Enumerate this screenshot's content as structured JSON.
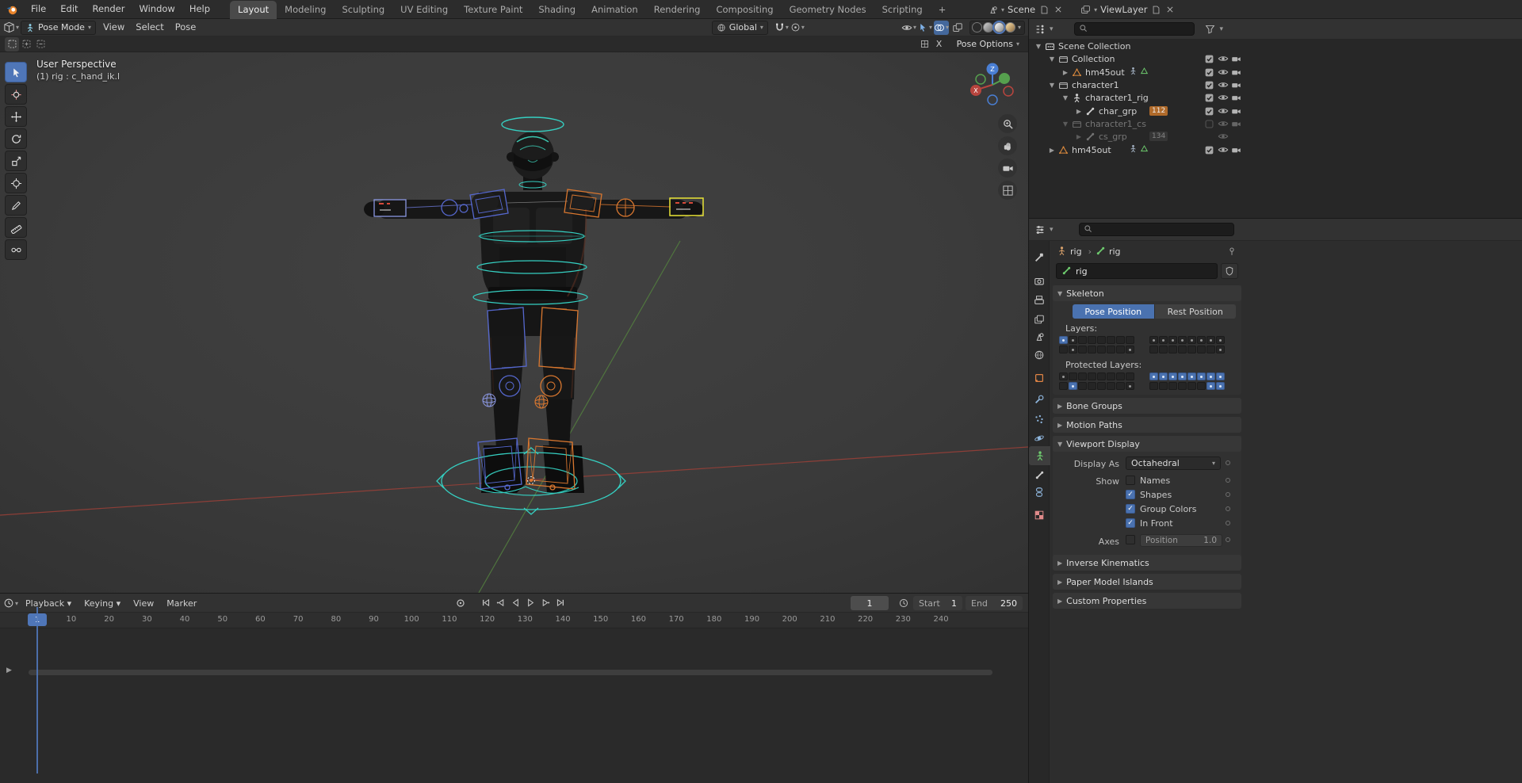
{
  "topbar": {
    "menus": [
      "File",
      "Edit",
      "Render",
      "Window",
      "Help"
    ],
    "tabs": [
      "Layout",
      "Modeling",
      "Sculpting",
      "UV Editing",
      "Texture Paint",
      "Shading",
      "Animation",
      "Rendering",
      "Compositing",
      "Geometry Nodes",
      "Scripting"
    ],
    "active_tab": "Layout",
    "add_tab_label": "+",
    "scene_label": "Scene",
    "view_layer_label": "ViewLayer"
  },
  "viewport": {
    "mode": "Pose Mode",
    "menus": [
      "View",
      "Select",
      "Pose"
    ],
    "orientation": "Global",
    "pose_options_label": "Pose Options",
    "mirror_x_label": "X",
    "perspective_label": "User Perspective",
    "active_object_label": "(1) rig : c_hand_ik.l",
    "axis_z": "Z",
    "axis_x": "X"
  },
  "outliner": {
    "rows": [
      {
        "label": "Scene Collection",
        "indent": 0,
        "icon": "scene-collection",
        "disclosure": "open",
        "dim": false,
        "controls": []
      },
      {
        "label": "Collection",
        "indent": 1,
        "icon": "collection",
        "disclosure": "open",
        "dim": false,
        "controls": [
          "check",
          "eye",
          "camera"
        ]
      },
      {
        "label": "hm45out",
        "indent": 2,
        "icon": "mesh",
        "disclosure": "closed",
        "dim": false,
        "extras": [
          "mod",
          "meshdata"
        ],
        "controls": [
          "check",
          "eye",
          "camera"
        ]
      },
      {
        "label": "character1",
        "indent": 1,
        "icon": "collection",
        "disclosure": "open",
        "dim": false,
        "controls": [
          "check",
          "eye",
          "camera"
        ]
      },
      {
        "label": "character1_rig",
        "indent": 2,
        "icon": "armature",
        "disclosure": "open",
        "dim": false,
        "controls": [
          "check",
          "eye",
          "camera"
        ]
      },
      {
        "label": "char_grp",
        "indent": 3,
        "icon": "bone",
        "disclosure": "closed",
        "dim": false,
        "badge": "112",
        "badge_style": "orange",
        "controls": [
          "check",
          "eye",
          "camera"
        ]
      },
      {
        "label": "character1_cs",
        "indent": 2,
        "icon": "collection",
        "disclosure": "open",
        "dim": true,
        "controls": [
          "uncheck",
          "eye",
          "camera"
        ]
      },
      {
        "label": "cs_grp",
        "indent": 3,
        "icon": "bone",
        "disclosure": "closed",
        "dim": true,
        "badge": "134",
        "badge_style": "gray",
        "controls": [
          "eye"
        ]
      },
      {
        "label": "hm45out",
        "indent": 1,
        "icon": "mesh",
        "disclosure": "closed",
        "dim": false,
        "extras": [
          "mod",
          "meshdata"
        ],
        "controls": [
          "check",
          "eye",
          "camera"
        ]
      }
    ]
  },
  "properties": {
    "tabs": [
      "tool",
      "render",
      "output",
      "view-layer",
      "scene",
      "world",
      "object",
      "modifiers",
      "particles",
      "physics",
      "data",
      "bone",
      "constraints",
      "texture"
    ],
    "active_tab": "data",
    "breadcrumb_object": "rig",
    "breadcrumb_data": "rig",
    "name_value": "rig",
    "skeleton_title": "Skeleton",
    "pose_position_label": "Pose Position",
    "rest_position_label": "Rest Position",
    "layers_label": "Layers:",
    "protected_layers_label": "Protected Layers:",
    "layers": {
      "row1_left": [
        2,
        1,
        0,
        0,
        0,
        0,
        0,
        0
      ],
      "row2_left": [
        0,
        1,
        0,
        0,
        0,
        0,
        0,
        1
      ],
      "row1_right": [
        1,
        1,
        1,
        1,
        1,
        1,
        1,
        1
      ],
      "row2_right": [
        0,
        0,
        0,
        0,
        0,
        0,
        0,
        1
      ]
    },
    "protected_layers": {
      "row1_left": [
        1,
        0,
        0,
        0,
        0,
        0,
        0,
        0
      ],
      "row2_left": [
        0,
        2,
        0,
        0,
        0,
        0,
        0,
        1
      ],
      "row1_right": [
        2,
        2,
        2,
        2,
        2,
        2,
        2,
        2
      ],
      "row2_right": [
        0,
        0,
        0,
        0,
        0,
        0,
        2,
        2
      ]
    },
    "bone_groups_title": "Bone Groups",
    "motion_paths_title": "Motion Paths",
    "viewport_display_title": "Viewport Display",
    "display_as_label": "Display As",
    "display_as_value": "Octahedral",
    "show_label": "Show",
    "show_options": [
      {
        "label": "Names",
        "checked": false
      },
      {
        "label": "Shapes",
        "checked": true
      },
      {
        "label": "Group Colors",
        "checked": true
      },
      {
        "label": "In Front",
        "checked": true
      }
    ],
    "axes_label": "Axes",
    "axes_checked": false,
    "position_label": "Position",
    "position_value": "1.0",
    "inverse_kinematics_title": "Inverse Kinematics",
    "paper_model_islands_title": "Paper Model Islands",
    "custom_properties_title": "Custom Properties"
  },
  "timeline": {
    "menus": [
      {
        "label": "Playback",
        "caret": true
      },
      {
        "label": "Keying",
        "caret": true
      },
      {
        "label": "View",
        "caret": false
      },
      {
        "label": "Marker",
        "caret": false
      }
    ],
    "current_frame": "1",
    "playhead_label": "1",
    "start_label": "Start",
    "start_value": "1",
    "end_label": "End",
    "end_value": "250",
    "ticks": [
      10,
      20,
      30,
      40,
      50,
      60,
      70,
      80,
      90,
      100,
      110,
      120,
      130,
      140,
      150,
      160,
      170,
      180,
      190,
      200,
      210,
      220,
      230,
      240
    ]
  }
}
